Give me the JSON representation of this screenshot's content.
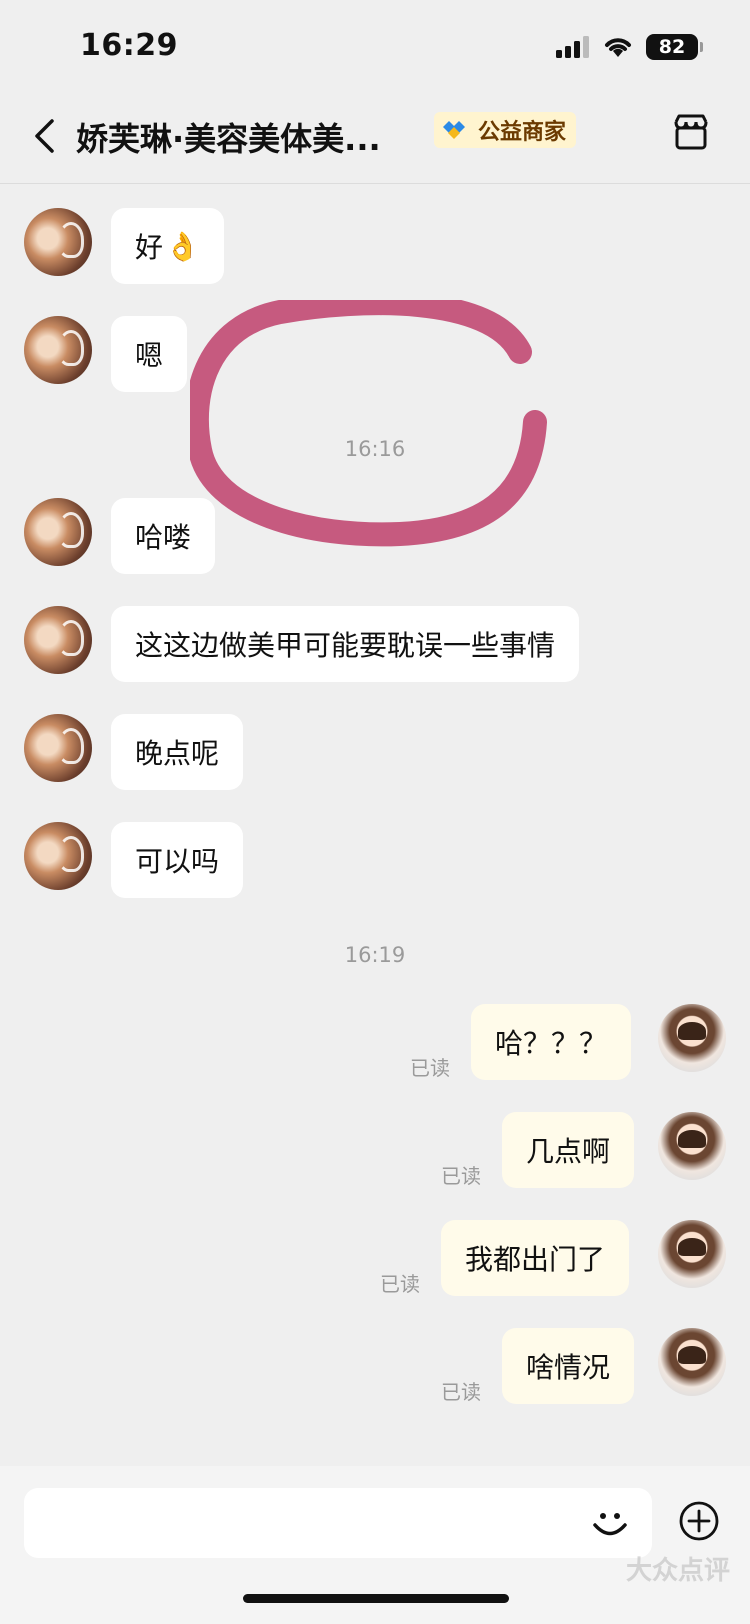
{
  "status_bar": {
    "time": "16:29",
    "battery": "82"
  },
  "header": {
    "title": "娇芙琳·美容美体美...",
    "badge": "公益商家"
  },
  "timestamps": [
    "16:16",
    "16:19"
  ],
  "messages_in": [
    {
      "text": "好",
      "emoji": "👌"
    },
    {
      "text": "嗯"
    },
    {
      "text": "哈喽"
    },
    {
      "text": "这这边做美甲可能要耽误一些事情"
    },
    {
      "text": "晚点呢"
    },
    {
      "text": "可以吗"
    }
  ],
  "messages_out": [
    {
      "text": "哈？？？",
      "status": "已读"
    },
    {
      "text": "几点啊",
      "status": "已读"
    },
    {
      "text": "我都出门了",
      "status": "已读"
    },
    {
      "text": "啥情况",
      "status": "已读"
    }
  ],
  "input": {
    "placeholder": ""
  },
  "watermark": "大众点评",
  "colors": {
    "annotation": "#c0466f",
    "badge_bg": "#fff4cf",
    "bubble_out": "#fffbea",
    "background": "#efefef"
  },
  "icons": [
    "back-arrow-icon",
    "badge-diamond-icon",
    "store-icon",
    "emoji-icon",
    "plus-icon"
  ]
}
